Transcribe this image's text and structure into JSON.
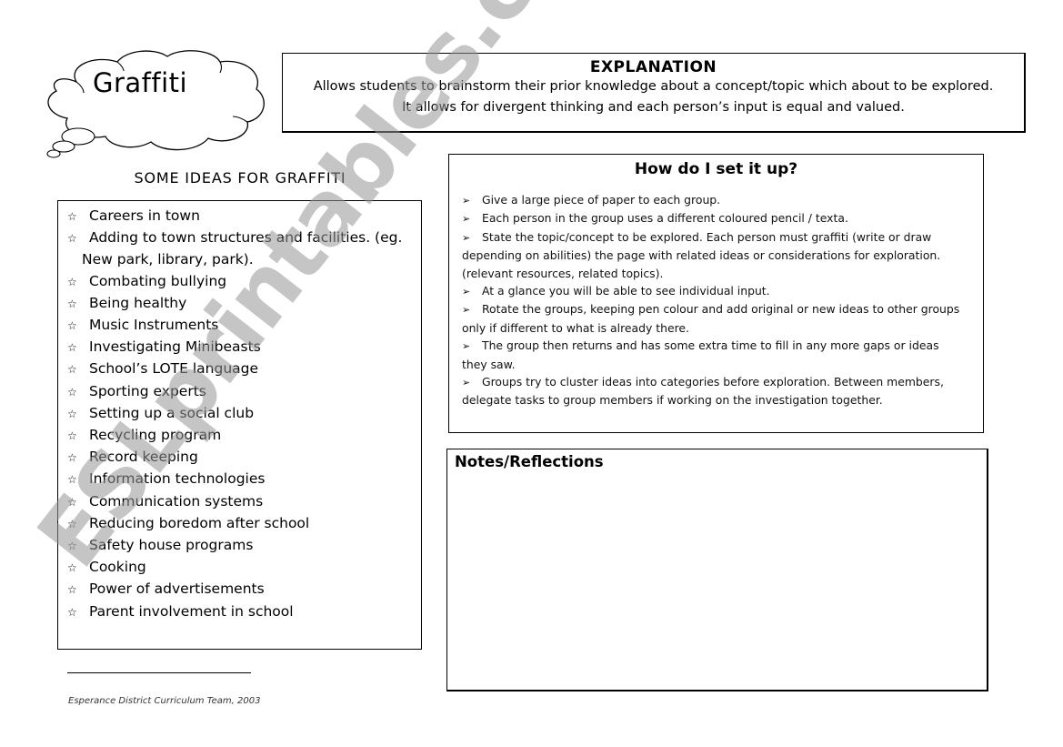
{
  "cloud": {
    "title": "Graffiti",
    "icon": "thought-cloud-icon"
  },
  "explanation": {
    "title": "EXPLANATION",
    "lines": [
      "Allows students to brainstorm their prior knowledge about a concept/topic which about to be explored.",
      "It allows for divergent thinking and each person’s input is equal and valued."
    ]
  },
  "ideas": {
    "heading": "SOME IDEAS FOR GRAFFITI",
    "bullet_icon": "☆",
    "items": [
      "Careers in town",
      "Adding to town structures and facilities. (eg.",
      "Combating bullying",
      "Being healthy",
      "Music Instruments",
      "Investigating Minibeasts",
      "School’s LOTE language",
      "Sporting experts",
      "Setting up a social club",
      "Recycling program",
      "Record keeping",
      "Information technologies",
      "Communication systems",
      "Reducing boredom after school",
      "Safety house programs",
      "Cooking",
      "Power of advertisements",
      "Parent involvement in school"
    ],
    "item_1_continuation": "New park, library, park)."
  },
  "setup": {
    "title": "How do I set it up?",
    "bullet_icon": "➢",
    "steps": [
      {
        "first": "Give a large piece of paper to each group.",
        "rest": []
      },
      {
        "first": "Each person in the group uses a different coloured pencil / texta.",
        "rest": []
      },
      {
        "first": "State the topic/concept to be explored. Each person must graffiti (write or draw",
        "rest": [
          "depending on abilities) the page with related ideas or considerations for exploration.",
          "(relevant resources, related topics)."
        ]
      },
      {
        "first": "At a glance you will be able to see individual input.",
        "rest": []
      },
      {
        "first": "Rotate the groups, keeping pen colour and add original or new ideas to other groups",
        "rest": [
          "only if different to what is already there."
        ]
      },
      {
        "first": "The group then returns and has some extra time to fill in any more gaps or ideas",
        "rest": [
          "they saw."
        ]
      },
      {
        "first": "Groups try to cluster ideas into categories before exploration.  Between members,",
        "rest": [
          "delegate tasks to group members if working on the investigation together."
        ]
      }
    ]
  },
  "notes": {
    "title": "Notes/Reflections"
  },
  "footer": {
    "credit": "Esperance District Curriculum Team, 2003"
  },
  "watermark": {
    "text": "ESLprintables.com"
  }
}
